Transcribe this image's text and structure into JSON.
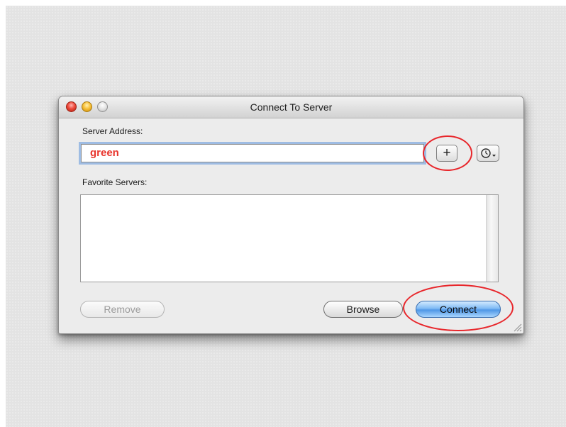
{
  "window": {
    "title": "Connect To Server"
  },
  "server_address": {
    "label": "Server Address:",
    "value": "green"
  },
  "favorites": {
    "label": "Favorite Servers:",
    "items": []
  },
  "buttons": {
    "add_label": "+",
    "remove_label": "Remove",
    "browse_label": "Browse",
    "connect_label": "Connect"
  },
  "icons": {
    "recent_servers": "clock-with-dropdown-icon",
    "add_favorite": "plus-icon",
    "resize": "resize-grip-icon"
  },
  "colors": {
    "input_text": "#e8342c",
    "annotation": "#e8262b",
    "default_button": "#6aa8ef"
  },
  "annotations": {
    "highlighted": [
      "add-favorite-button",
      "connect-button"
    ]
  }
}
